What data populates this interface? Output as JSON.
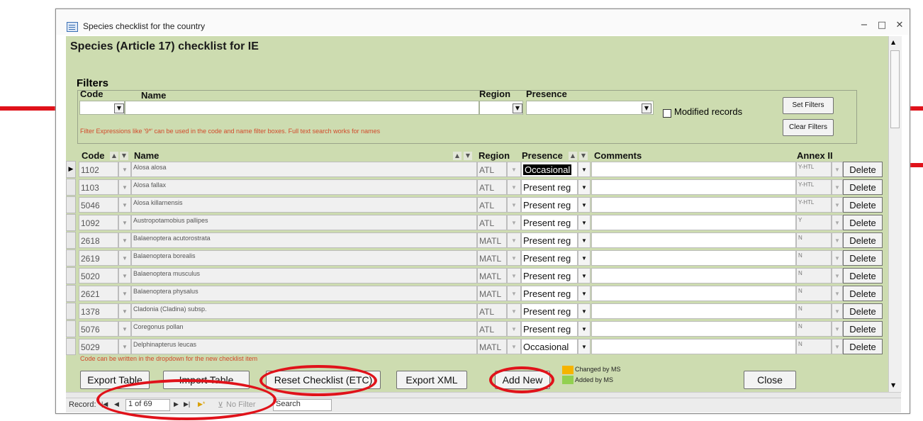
{
  "window": {
    "title": "Species checklist for the country",
    "minimize": "−",
    "maximize": "□",
    "close": "✕"
  },
  "form": {
    "title": "Species (Article 17) checklist for IE"
  },
  "filters": {
    "heading": "Filters",
    "code_label": "Code",
    "name_label": "Name",
    "region_label": "Region",
    "presence_label": "Presence",
    "modified_label": "Modified records",
    "set_filters": "Set Filters",
    "clear_filters": "Clear Filters",
    "hint": "Filter Expressions like '9*' can be used in the code and name filter boxes. Full text search works for names"
  },
  "table": {
    "headers": {
      "code": "Code",
      "name": "Name",
      "region": "Region",
      "presence": "Presence",
      "comments": "Comments",
      "annex": "Annex II"
    },
    "delete_label": "Delete",
    "rows": [
      {
        "code": "1102",
        "name": "Alosa alosa",
        "region": "ATL",
        "presence": "Occasional",
        "annex": "Y-HTL"
      },
      {
        "code": "1103",
        "name": "Alosa fallax",
        "region": "ATL",
        "presence": "Present reg",
        "annex": "Y-HTL"
      },
      {
        "code": "5046",
        "name": "Alosa killarnensis",
        "region": "ATL",
        "presence": "Present reg",
        "annex": "Y-HTL"
      },
      {
        "code": "1092",
        "name": "Austropotamobius pallipes",
        "region": "ATL",
        "presence": "Present reg",
        "annex": "Y"
      },
      {
        "code": "2618",
        "name": "Balaenoptera acutorostrata",
        "region": "MATL",
        "presence": "Present reg",
        "annex": "N"
      },
      {
        "code": "2619",
        "name": "Balaenoptera borealis",
        "region": "MATL",
        "presence": "Present reg",
        "annex": "N"
      },
      {
        "code": "5020",
        "name": "Balaenoptera musculus",
        "region": "MATL",
        "presence": "Present reg",
        "annex": "N"
      },
      {
        "code": "2621",
        "name": "Balaenoptera physalus",
        "region": "MATL",
        "presence": "Present reg",
        "annex": "N"
      },
      {
        "code": "1378",
        "name": "Cladonia (Cladina) subsp.",
        "region": "ATL",
        "presence": "Present reg",
        "annex": "N"
      },
      {
        "code": "5076",
        "name": "Coregonus pollan",
        "region": "ATL",
        "presence": "Present reg",
        "annex": "N"
      },
      {
        "code": "5029",
        "name": "Delphinapterus leucas",
        "region": "MATL",
        "presence": "Occasional",
        "annex": "N"
      }
    ],
    "note": "Code can be written in the dropdown for the new checklist item"
  },
  "actions": {
    "export_table": "Export Table",
    "import_table": "Import Table",
    "reset_checklist": "Reset Checklist (ETC)",
    "export_xml": "Export XML",
    "add_new": "Add New",
    "close": "Close"
  },
  "legend": {
    "changed_label": "Changed by MS",
    "added_label": "Added by MS",
    "changed_color": "#f5b400",
    "added_color": "#92d050"
  },
  "navbar": {
    "record_label": "Record:",
    "position": "1 of 69",
    "no_filter": "No Filter",
    "search": "Search"
  },
  "annotation_color": "#e0121a"
}
